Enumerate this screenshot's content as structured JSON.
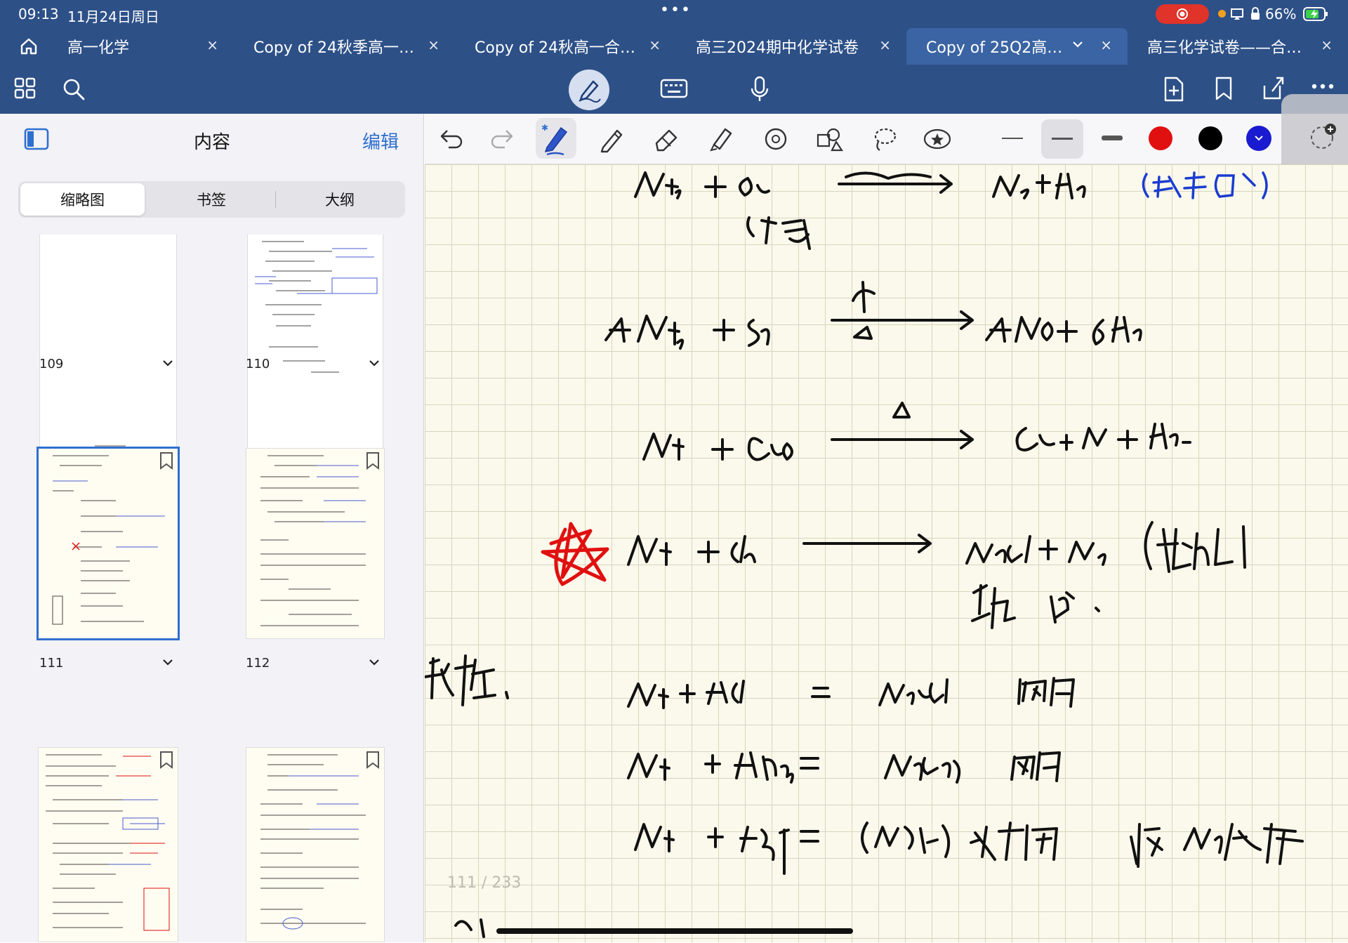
{
  "status": {
    "time": "09:13",
    "date": "11月24日周日",
    "battery": "66%"
  },
  "tabs": [
    {
      "label": "高一化学",
      "active": false
    },
    {
      "label": "Copy of 24秋季高一…",
      "active": false
    },
    {
      "label": "Copy of 24秋高一合…",
      "active": false
    },
    {
      "label": "高三2024期中化学试卷",
      "active": false
    },
    {
      "label": "Copy of 25Q2高…",
      "active": true
    },
    {
      "label": "高三化学试卷——合…",
      "active": false
    }
  ],
  "close_glyph": "×",
  "sidebar": {
    "title": "内容",
    "edit_label": "编辑",
    "segments": [
      "缩略图",
      "书签",
      "大纲"
    ],
    "pages": [
      "109",
      "110",
      "111",
      "112"
    ]
  },
  "page_indicator": "111 / 233",
  "colors": {
    "toolbar": "#2d5087",
    "accent": "#2f6fcf",
    "red": "#e01010",
    "black": "#000000",
    "blue": "#1a1ad0"
  },
  "handwriting": [
    "NH3 + O2 (纯氧) → N2 + H2O (绿火焰)",
    "4NH3 + 5O2 催/△ → 4NO + 6H2O",
    "NH3 + CuO △ → Cu + N2 + H2O",
    "NH3 + Cl2 → NH4Cl + N2 (检Cl2泄漏) 碱 还",
    "碱性:",
    "NH3 + HCl = NH4Cl 白烟",
    "NH3 + HNO3 = NH4NO3 白烟",
    "NH3 + H2SO4 = (NH4)2SO4 无白烟 吸NH3气体"
  ]
}
